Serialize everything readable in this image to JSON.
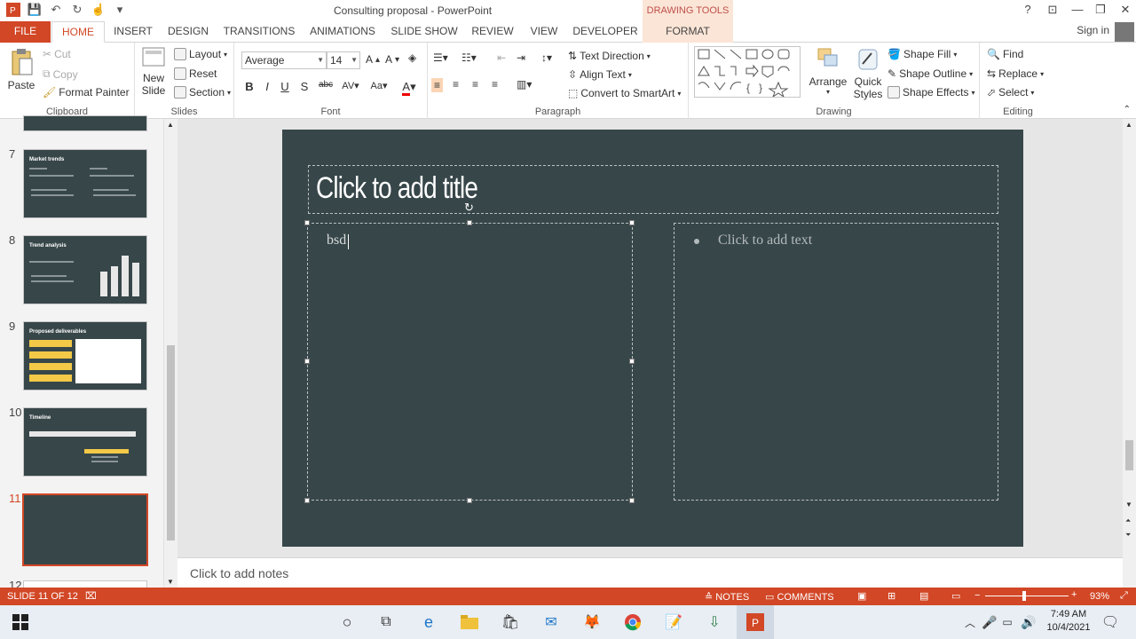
{
  "window": {
    "title": "Consulting proposal - PowerPoint",
    "context_tab_group": "DRAWING TOOLS",
    "help": "?",
    "sign_in": "Sign in"
  },
  "tabs": {
    "file": "FILE",
    "home": "HOME",
    "insert": "INSERT",
    "design": "DESIGN",
    "transitions": "TRANSITIONS",
    "animations": "ANIMATIONS",
    "slide_show": "SLIDE SHOW",
    "review": "REVIEW",
    "view": "VIEW",
    "developer": "DEVELOPER",
    "format": "FORMAT"
  },
  "ribbon": {
    "clipboard": {
      "label": "Clipboard",
      "paste": "Paste",
      "cut": "Cut",
      "copy": "Copy",
      "format_painter": "Format Painter"
    },
    "slides": {
      "label": "Slides",
      "new_slide_1": "New",
      "new_slide_2": "Slide",
      "layout": "Layout",
      "reset": "Reset",
      "section": "Section"
    },
    "font": {
      "label": "Font",
      "font_name": "Average",
      "font_size": "14"
    },
    "paragraph": {
      "label": "Paragraph",
      "text_direction": "Text Direction",
      "align_text": "Align Text",
      "convert_smartart": "Convert to SmartArt"
    },
    "drawing": {
      "label": "Drawing",
      "arrange": "Arrange",
      "quick_styles_1": "Quick",
      "quick_styles_2": "Styles",
      "shape_fill": "Shape Fill",
      "shape_outline": "Shape Outline",
      "shape_effects": "Shape Effects"
    },
    "editing": {
      "label": "Editing",
      "find": "Find",
      "replace": "Replace",
      "select": "Select"
    }
  },
  "thumbnails": [
    {
      "num": "7",
      "title": "Market trends"
    },
    {
      "num": "8",
      "title": "Trend analysis"
    },
    {
      "num": "9",
      "title": "Proposed deliverables"
    },
    {
      "num": "10",
      "title": "Timeline"
    },
    {
      "num": "11",
      "title": ""
    },
    {
      "num": "12",
      "title": ""
    }
  ],
  "slide": {
    "title_placeholder": "Click to add title",
    "left_text": "bsd",
    "right_placeholder": "Click to add text"
  },
  "notes": {
    "placeholder": "Click to add notes"
  },
  "status": {
    "slide_info": "SLIDE 11 OF 12",
    "notes": "NOTES",
    "comments": "COMMENTS",
    "zoom": "93%"
  },
  "taskbar": {
    "time": "7:49 AM",
    "date": "10/4/2021"
  }
}
